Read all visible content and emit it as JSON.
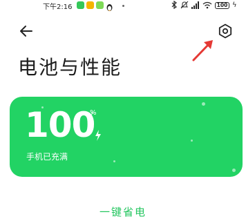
{
  "status_bar": {
    "time": "下午2:16",
    "battery_level": "100",
    "colors": {
      "app1": "#34c759",
      "app2": "#f5b400",
      "app3": "#7ed957"
    }
  },
  "header": {
    "back_icon": "back-arrow-icon",
    "settings_icon": "gear-icon"
  },
  "page": {
    "title": "电池与性能"
  },
  "battery_card": {
    "percent": "100",
    "percent_unit": "%",
    "status": "手机已充满",
    "color": "#22d364"
  },
  "actions": {
    "power_save_label": "一键省电"
  },
  "annotation": {
    "arrow_color": "#e53935"
  }
}
